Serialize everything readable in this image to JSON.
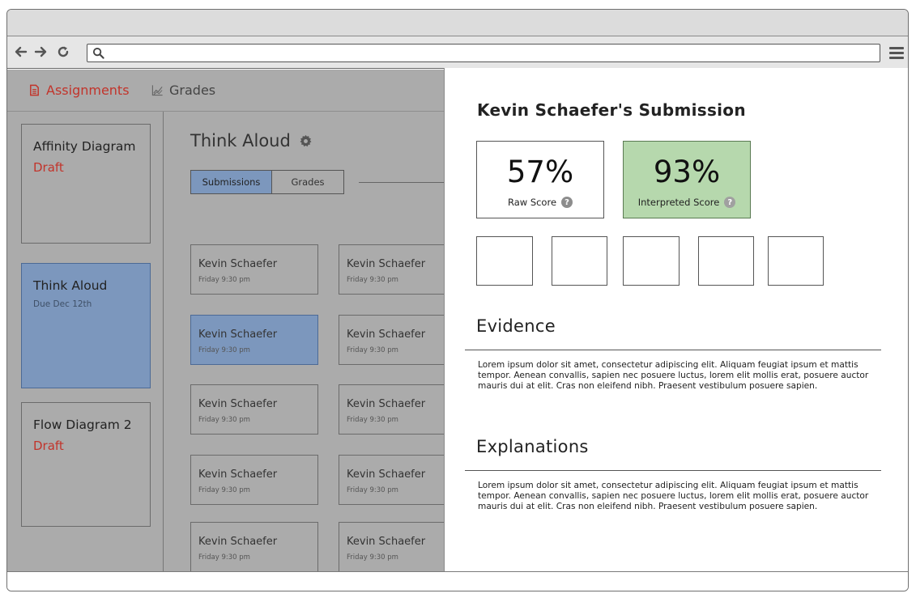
{
  "browser": {
    "url": "",
    "nav_icons": [
      "back-arrow-icon",
      "forward-arrow-icon",
      "reload-icon"
    ]
  },
  "topnav": {
    "assignments_label": "Assignments",
    "grades_label": "Grades"
  },
  "assignments": [
    {
      "title": "Affinity Diagram",
      "status": "Draft"
    },
    {
      "title": "Think Aloud",
      "status": "Due Dec 12th"
    },
    {
      "title": "Flow Diagram 2",
      "status": "Draft"
    }
  ],
  "main": {
    "title": "Think Aloud",
    "tabs": [
      {
        "label": "Submissions"
      },
      {
        "label": "Grades"
      }
    ],
    "submissions": [
      {
        "name": "Kevin Schaefer",
        "time": "Friday 9:30 pm"
      },
      {
        "name": "Kevin Schaefer",
        "time": "Friday 9:30 pm"
      },
      {
        "name": "Kevin Schaefer",
        "time": "Friday 9:30 pm"
      },
      {
        "name": "Kevin Schaefer",
        "time": "Friday 9:30 pm"
      },
      {
        "name": "Kevin Schaefer",
        "time": "Friday 9:30 pm"
      },
      {
        "name": "Kevin Schaefer",
        "time": "Friday 9:30 pm"
      },
      {
        "name": "Kevin Schaefer",
        "time": "Friday 9:30 pm"
      },
      {
        "name": "Kevin Schaefer",
        "time": "Friday 9:30 pm"
      },
      {
        "name": "Kevin Schaefer",
        "time": "Friday 9:30 pm"
      },
      {
        "name": "Kevin Schaefer",
        "time": "Friday 9:30 pm"
      }
    ]
  },
  "panel": {
    "title": "Kevin Schaefer's Submission",
    "raw_score": "57%",
    "raw_label": "Raw Score",
    "interp_score": "93%",
    "interp_label": "Interpreted Score",
    "help_glyph": "?",
    "evidence_heading": "Evidence",
    "evidence_text": "Lorem ipsum dolor sit amet, consectetur adipiscing elit. Aliquam feugiat ipsum et mattis tempor. Aenean convallis, sapien nec posuere luctus, lorem elit mollis erat, posuere auctor mauris dui at elit. Cras non eleifend nibh. Praesent vestibulum posuere sapien.",
    "explanations_heading": "Explanations",
    "explanations_text": "Lorem ipsum dolor sit amet, consectetur adipiscing elit. Aliquam feugiat ipsum et mattis tempor. Aenean convallis, sapien nec posuere luctus, lorem elit mollis erat, posuere auctor mauris dui at elit. Cras non eleifend nibh. Praesent vestibulum posuere sapien."
  },
  "colors": {
    "accent_red": "#c2342b",
    "selected_blue": "#7c97bd",
    "score_green": "#b6d8ad"
  }
}
